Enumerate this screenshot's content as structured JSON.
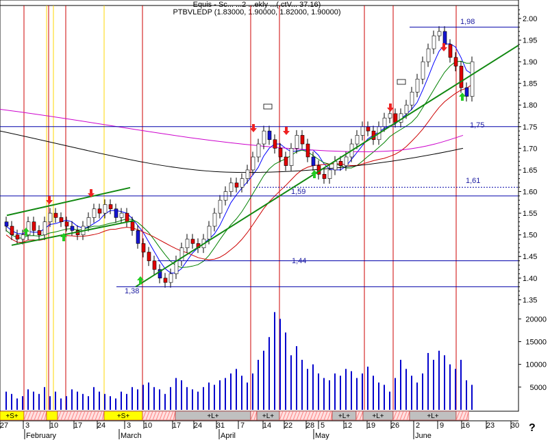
{
  "header": {
    "line1": "Equis - Sc... ...2 ...ekly ...(.ctV... 37.16)",
    "line2": "PTBVLEDP (1.83000, 1.90000, 1.82000, 1.90000)"
  },
  "help_mark": "?",
  "colors": {
    "up_candle": "#ffffff",
    "down_candle": "#e00000",
    "buy_candle": "#1515d0",
    "ma_short": "#0000ff",
    "ma_mid": "#008000",
    "ma_long_red": "#cc0000",
    "ma_magenta": "#cc00cc",
    "ma_black": "#000000",
    "trend": "#118811",
    "volume": "#0000cc",
    "event_line": "#cc0000",
    "yellow_line": "#ffd700",
    "level_line": "#0000aa",
    "arrow_buy": "#22cc22",
    "arrow_sell": "#ee2222",
    "band_s": "#ffff00",
    "band_l": "#c0c0c0",
    "band_x": "#ff8080"
  },
  "chart_data": {
    "type": "candlestick",
    "title": "PTBVLEDP (1.83000, 1.90000, 1.82000, 1.90000)",
    "price_axis": {
      "ticks": [
        "2.00",
        "1.95",
        "1.90",
        "1.85",
        "1.80",
        "1.75",
        "1.70",
        "1.65",
        "1.60",
        "1.55",
        "1.50",
        "1.45",
        "1.40",
        "1.35"
      ],
      "ylim": [
        1.33,
        2.03
      ]
    },
    "volume_axis": {
      "ticks": [
        "20000",
        "15000",
        "10000",
        "5000"
      ],
      "ylim": [
        0,
        22000
      ]
    },
    "x_axis": {
      "day_labels": [
        "27",
        "3",
        "10",
        "17",
        "24",
        "3",
        "10",
        "17",
        "24",
        "31",
        "7",
        "14",
        "22",
        "28",
        "5",
        "12",
        "19",
        "26",
        "2",
        "9",
        "16",
        "23",
        "30"
      ],
      "month_labels": [
        "February",
        "March",
        "April",
        "May",
        "June"
      ]
    },
    "level_labels": [
      "1,98",
      "1,75",
      "1,61",
      "1,59",
      "1,44",
      "1,38"
    ],
    "level_values": [
      1.98,
      1.75,
      1.61,
      1.59,
      1.44,
      1.38
    ],
    "signal_bands": [
      {
        "label": "+S+",
        "kind": "s"
      },
      {
        "label": "",
        "kind": "x"
      },
      {
        "label": "",
        "kind": "s"
      },
      {
        "label": "",
        "kind": "x"
      },
      {
        "label": "+S+",
        "kind": "s"
      },
      {
        "label": "",
        "kind": "x"
      },
      {
        "label": "+L+",
        "kind": "l"
      },
      {
        "label": "",
        "kind": "x"
      },
      {
        "label": "+L+",
        "kind": "l"
      },
      {
        "label": "",
        "kind": "x"
      },
      {
        "label": "+L+",
        "kind": "l"
      },
      {
        "label": "",
        "kind": "x"
      },
      {
        "label": "+L+",
        "kind": "l"
      },
      {
        "label": "",
        "kind": "x"
      },
      {
        "label": "+L+",
        "kind": "l"
      },
      {
        "label": "",
        "kind": "x"
      }
    ],
    "closes": [
      1.52,
      1.5,
      1.49,
      1.5,
      1.53,
      1.51,
      1.5,
      1.53,
      1.55,
      1.54,
      1.53,
      1.52,
      1.51,
      1.5,
      1.52,
      1.54,
      1.56,
      1.55,
      1.57,
      1.56,
      1.54,
      1.55,
      1.53,
      1.51,
      1.48,
      1.46,
      1.44,
      1.42,
      1.4,
      1.39,
      1.41,
      1.44,
      1.47,
      1.49,
      1.48,
      1.47,
      1.49,
      1.52,
      1.55,
      1.58,
      1.6,
      1.62,
      1.61,
      1.63,
      1.65,
      1.68,
      1.71,
      1.74,
      1.72,
      1.7,
      1.68,
      1.66,
      1.7,
      1.73,
      1.71,
      1.68,
      1.66,
      1.64,
      1.63,
      1.65,
      1.67,
      1.66,
      1.68,
      1.71,
      1.73,
      1.75,
      1.74,
      1.72,
      1.75,
      1.77,
      1.78,
      1.76,
      1.78,
      1.8,
      1.83,
      1.86,
      1.9,
      1.93,
      1.96,
      1.97,
      1.94,
      1.91,
      1.89,
      1.84,
      1.82,
      1.9
    ],
    "volumes": [
      4000,
      3500,
      2500,
      3000,
      4500,
      4000,
      3500,
      5000,
      3000,
      4000,
      2500,
      3000,
      4500,
      4000,
      3500,
      3000,
      5000,
      4000,
      3500,
      3000,
      2500,
      4000,
      3500,
      5000,
      4500,
      5500,
      6000,
      5000,
      4500,
      3500,
      5000,
      7000,
      6500,
      5000,
      4500,
      4000,
      5000,
      6000,
      5500,
      6500,
      7000,
      8000,
      9000,
      7500,
      6000,
      8000,
      11000,
      13000,
      16000,
      21500,
      20000,
      17000,
      12000,
      14000,
      11000,
      9000,
      10000,
      8000,
      7000,
      6500,
      8000,
      7500,
      9000,
      8500,
      7000,
      8000,
      9500,
      7500,
      6000,
      5500,
      4000,
      7000,
      11000,
      9000,
      7500,
      6000,
      8000,
      12500,
      11000,
      13000,
      12000,
      10000,
      9000,
      11000,
      6500,
      5500
    ],
    "volume_groups": [
      {
        "start": 0,
        "end": 28,
        "scale": 0.85
      },
      {
        "start": 29,
        "end": 56,
        "scale": 1.0
      },
      {
        "start": 57,
        "end": 85,
        "scale": 0.9
      }
    ]
  }
}
